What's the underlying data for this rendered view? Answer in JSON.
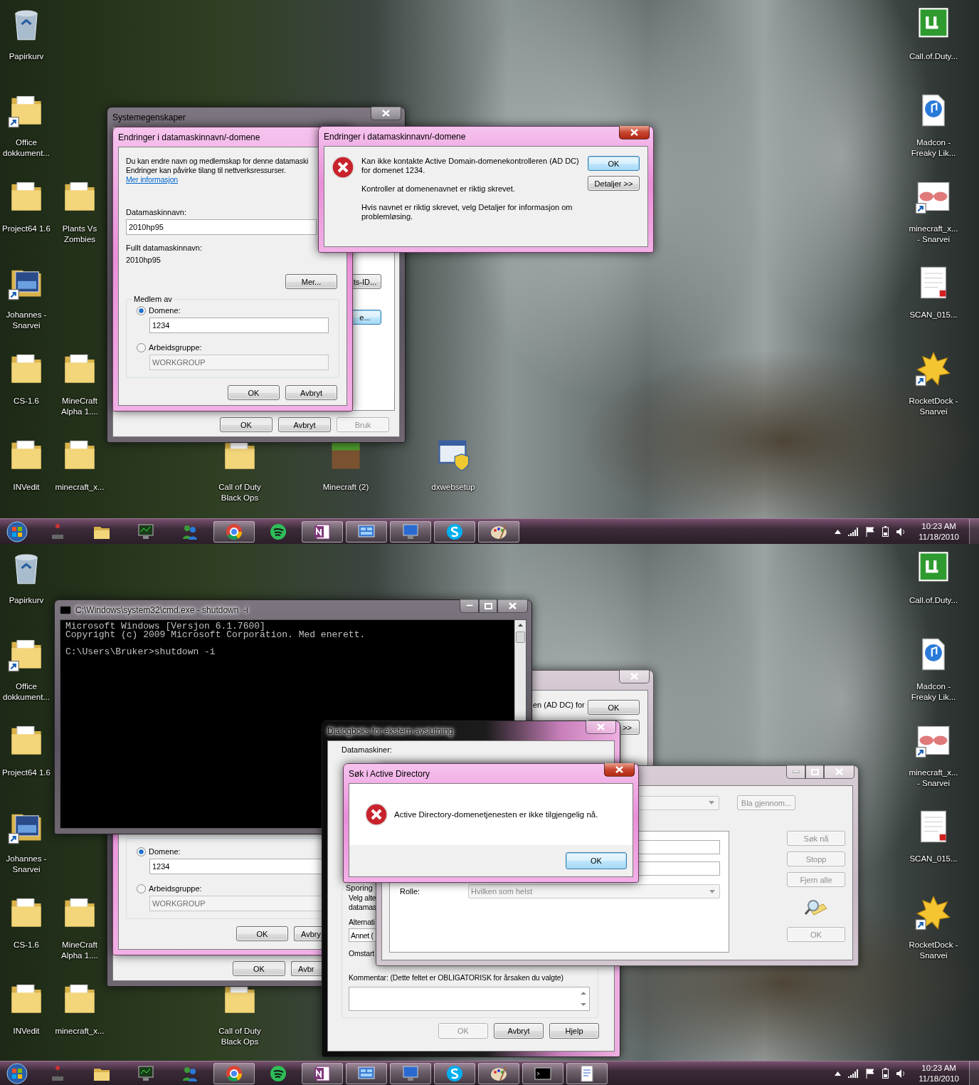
{
  "screens": [
    {
      "desktop_icons": [
        {
          "label": "Papirkurv",
          "kind": "recycle-bin",
          "shortcut": false
        },
        {
          "label": "Office dokkument...",
          "kind": "folder",
          "shortcut": true
        },
        {
          "label": "Project64 1.6",
          "kind": "folder",
          "shortcut": false
        },
        {
          "label": "Plants Vs Zombies",
          "kind": "folder",
          "shortcut": false
        },
        {
          "label": "Johannes - Snarvei",
          "kind": "image",
          "shortcut": true
        },
        {
          "label": "CS-1.6",
          "kind": "folder",
          "shortcut": false
        },
        {
          "label": "MineCraft Alpha 1....",
          "kind": "folder",
          "shortcut": false
        },
        {
          "label": "INVedit",
          "kind": "folder",
          "shortcut": false
        },
        {
          "label": "minecraft_x...",
          "kind": "folder",
          "shortcut": false
        },
        {
          "label": "Call of Duty Black Ops",
          "kind": "folder",
          "shortcut": false
        },
        {
          "label": "Minecraft (2)",
          "kind": "block",
          "shortcut": false
        },
        {
          "label": "dxwebsetup",
          "kind": "installer",
          "shortcut": false
        },
        {
          "label": "Call.of.Duty...",
          "kind": "torrent",
          "shortcut": false
        },
        {
          "label": "Madcon - Freaky Lik...",
          "kind": "music",
          "shortcut": false
        },
        {
          "label": "minecraft_x... - Snarvei",
          "kind": "glasses",
          "shortcut": true
        },
        {
          "label": "SCAN_015...",
          "kind": "pdf",
          "shortcut": false
        },
        {
          "label": "RocketDock - Snarvei",
          "kind": "dock",
          "shortcut": true
        }
      ],
      "system_properties": {
        "title": "Systemegenskaper",
        "side_buttons": [
          {
            "label": "ts-ID...",
            "default": false
          },
          {
            "label": "e...",
            "default": true
          }
        ],
        "buttons": [
          {
            "label": "OK",
            "disabled": false
          },
          {
            "label": "Avbryt",
            "disabled": false
          },
          {
            "label": "Bruk",
            "disabled": true
          }
        ]
      },
      "name_dialog": {
        "title": "Endringer i datamaskinnavn/-domene",
        "intro_lines": [
          "Du kan endre navn og medlemskap for denne datamaski",
          "Endringer kan påvirke tilang til nettverksressurser."
        ],
        "link": "Mer informasjon",
        "name_label": "Datamaskinnavn:",
        "name_value": "2010hp95",
        "full_name_label": "Fullt datamaskinnavn:",
        "full_name_value": "2010hp95",
        "more_button": "Mer...",
        "member_legend": "Medlem av",
        "options": [
          {
            "label": "Domene:",
            "selected": true,
            "value": "1234"
          },
          {
            "label": "Arbeidsgruppe:",
            "selected": false,
            "value": "WORKGROUP"
          }
        ],
        "buttons": [
          {
            "label": "OK",
            "disabled": false
          },
          {
            "label": "Avbryt",
            "disabled": false
          }
        ]
      },
      "error_dialog": {
        "title": "Endringer i datamaskinnavn/-domene",
        "paragraphs": [
          "Kan ikke kontakte Active Domain-domenekontrolleren (AD DC) for domenet 1234.",
          "Kontroller at domenenavnet er riktig skrevet.",
          "Hvis navnet er riktig skrevet, velg Detaljer for informasjon om problemløsing."
        ],
        "buttons": [
          {
            "label": "OK",
            "default": true
          },
          {
            "label": "Detaljer >>",
            "default": false
          }
        ]
      },
      "taskbar": {
        "buttons": [
          {
            "kind": "joystick",
            "running": false
          },
          {
            "kind": "explorer",
            "running": false
          },
          {
            "kind": "monitor",
            "running": false
          },
          {
            "kind": "messenger",
            "running": false
          },
          {
            "kind": "browser",
            "running": true
          },
          {
            "kind": "music-app",
            "running": false
          },
          {
            "kind": "notebook",
            "running": true
          },
          {
            "kind": "control-panel",
            "running": true
          },
          {
            "kind": "computer",
            "running": true
          },
          {
            "kind": "chat",
            "running": true
          },
          {
            "kind": "paint",
            "running": true
          }
        ],
        "time": "10:23 AM",
        "date": "11/18/2010"
      }
    },
    {
      "desktop_icons": [
        {
          "label": "Papirkurv",
          "kind": "recycle-bin",
          "shortcut": false
        },
        {
          "label": "Office dokkument...",
          "kind": "folder",
          "shortcut": true
        },
        {
          "label": "Project64 1.6",
          "kind": "folder",
          "shortcut": false
        },
        {
          "label": "Johannes - Snarvei",
          "kind": "image",
          "shortcut": true
        },
        {
          "label": "CS-1.6",
          "kind": "folder",
          "shortcut": false
        },
        {
          "label": "MineCraft Alpha 1....",
          "kind": "folder",
          "shortcut": false
        },
        {
          "label": "INVedit",
          "kind": "folder",
          "shortcut": false
        },
        {
          "label": "minecraft_x...",
          "kind": "folder",
          "shortcut": false
        },
        {
          "label": "Call of Duty Black Ops",
          "kind": "folder",
          "shortcut": false
        },
        {
          "label": "Call.of.Duty...",
          "kind": "torrent",
          "shortcut": false
        },
        {
          "label": "Madcon - Freaky Lik...",
          "kind": "music",
          "shortcut": false
        },
        {
          "label": "minecraft_x... - Snarvei",
          "kind": "glasses",
          "shortcut": true
        },
        {
          "label": "SCAN_015...",
          "kind": "pdf",
          "shortcut": false
        },
        {
          "label": "RocketDock - Snarvei",
          "kind": "dock",
          "shortcut": true
        }
      ],
      "system_properties": {
        "buttons": [
          {
            "label": "OK",
            "disabled": false
          },
          {
            "label": "Avbr",
            "disabled": false
          }
        ]
      },
      "name_dialog": {
        "options": [
          {
            "label": "Domene:",
            "selected": true,
            "value": "1234"
          },
          {
            "label": "Arbeidsgruppe:",
            "selected": false,
            "value": "WORKGROUP"
          }
        ],
        "buttons": [
          {
            "label": "OK",
            "disabled": false
          },
          {
            "label": "Avbry",
            "disabled": false
          }
        ]
      },
      "error_dialog": {
        "paragraphs": [
          "en (AD DC) for"
        ],
        "buttons": [
          {
            "label": "OK",
            "default": false
          },
          {
            "label": ">>",
            "default": false
          }
        ]
      },
      "console": {
        "title": "C:\\Windows\\system32\\cmd.exe - shutdown  -i",
        "header_lines": [
          "Microsoft Windows [Versjon 6.1.7600]",
          "Copyright (c) 2009 Microsoft Corporation. Med enerett."
        ],
        "prompt": "C:\\Users\\Bruker>shutdown -i"
      },
      "shutdown_dialog": {
        "title": "Dialogboks for ekstern avslutning",
        "computers_label": "Datamaskiner:",
        "tracking_legend": "Sporing",
        "tracking_prompt_lines": [
          "Velg alte",
          "datamas"
        ],
        "option_label": "Alternati",
        "reason_value": "Annet (",
        "restart_label": "Omstart",
        "comment_label": "Kommentar: (Dette feltet er OBLIGATORISK for årsaken du valgte)",
        "buttons": [
          {
            "label": "OK",
            "disabled": true
          },
          {
            "label": "Avbryt",
            "disabled": false
          },
          {
            "label": "Hjelp",
            "disabled": false
          }
        ]
      },
      "search_window": {
        "browse_button": {
          "label": "Bla gjennom...",
          "disabled": true
        },
        "role_label": "Rolle:",
        "role_value": "Hvilken som helst",
        "buttons": [
          {
            "label": "Søk nå",
            "disabled": true
          },
          {
            "label": "Stopp",
            "disabled": true
          },
          {
            "label": "Fjern alle",
            "disabled": true
          }
        ],
        "ok_button": {
          "label": "OK",
          "disabled": true
        }
      },
      "search_error": {
        "title": "Søk i Active Directory",
        "message": "Active Directory-domenetjenesten er ikke tilgjengelig nå.",
        "button": {
          "label": "OK",
          "default": true
        }
      },
      "taskbar": {
        "buttons": [
          {
            "kind": "joystick",
            "running": false
          },
          {
            "kind": "explorer",
            "running": false
          },
          {
            "kind": "monitor",
            "running": false
          },
          {
            "kind": "messenger",
            "running": false
          },
          {
            "kind": "browser",
            "running": true
          },
          {
            "kind": "music-app",
            "running": false
          },
          {
            "kind": "notebook",
            "running": true
          },
          {
            "kind": "control-panel",
            "running": true
          },
          {
            "kind": "computer",
            "running": true
          },
          {
            "kind": "chat",
            "running": true
          },
          {
            "kind": "paint",
            "running": true
          },
          {
            "kind": "terminal",
            "running": true
          },
          {
            "kind": "document",
            "running": true
          }
        ],
        "time": "10:23 AM",
        "date": "11/18/2010"
      }
    }
  ]
}
